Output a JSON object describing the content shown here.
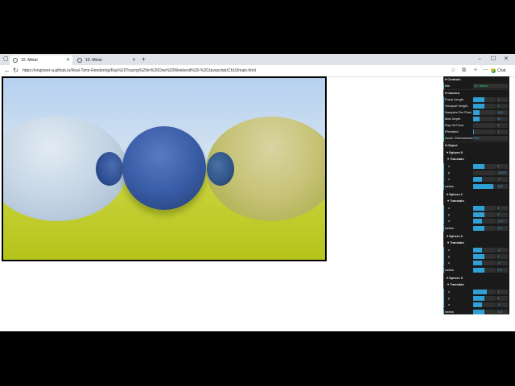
{
  "tabs": [
    {
      "label": "10. Metal",
      "active": true
    },
    {
      "label": "10. Metal",
      "active": false
    }
  ],
  "address": {
    "url": "https://engineer-a.github.io/Real-Time-Rendering/Ray%20Tracing%20in%20One%20Weekend%20-%20Javascript/Ch10/main.html"
  },
  "chat_label": "Chat",
  "scene": {
    "spheres": [
      {
        "color": "#c7d7e6",
        "shape": "left metal sphere"
      },
      {
        "color": "#2e4e93",
        "shape": "small blue sphere"
      },
      {
        "color": "#3a5da8",
        "shape": "center diffuse sphere"
      },
      {
        "color": "#2f5487",
        "shape": "small blue sphere"
      },
      {
        "color": "#c8c47a",
        "shape": "right gold metal sphere"
      }
    ]
  },
  "panel": {
    "controls_title": "Controls",
    "title_label": "title",
    "title_value": "10. Metal",
    "camera_title": "Camera",
    "camera": [
      {
        "label": "Focal Length",
        "value": "1",
        "fill": 0.5
      },
      {
        "label": "Viewport Height",
        "value": "2",
        "fill": 0.5
      },
      {
        "label": "Samples Per Pixel",
        "value": "100",
        "fill": 0.3
      },
      {
        "label": "Max Depth",
        "value": "50",
        "fill": 0.3
      },
      {
        "label": "Ray Hit Floor",
        "value": "0",
        "fill": 0.0
      },
      {
        "label": "Pixelated",
        "value": "1",
        "fill": 0.05
      }
    ],
    "accel_label": "Accel. Performance",
    "accel_value": "Yes",
    "object_title": "Object",
    "spheres": [
      {
        "title": "Sphere 0",
        "translate": "Translate",
        "x": "0",
        "y": "-100.5",
        "z": "-1",
        "radius_label": "radius",
        "radius": "100",
        "fx": 0.5,
        "fy": 0.0,
        "fz": 0.4,
        "fr": 0.9
      },
      {
        "title": "Sphere 1",
        "translate": "Translate",
        "x": "0",
        "y": "0",
        "z": "-1.2",
        "radius_label": "radius",
        "radius": "0.5",
        "fx": 0.5,
        "fy": 0.5,
        "fz": 0.4,
        "fr": 0.5
      },
      {
        "title": "Sphere 2",
        "translate": "Translate",
        "x": "-1",
        "y": "0",
        "z": "-1",
        "radius_label": "radius",
        "radius": "0.5",
        "fx": 0.4,
        "fy": 0.5,
        "fz": 0.4,
        "fr": 0.5
      },
      {
        "title": "Sphere 3",
        "translate": "Translate",
        "x": "1",
        "y": "0",
        "z": "-1",
        "radius_label": "radius",
        "radius": "0.5",
        "fx": 0.6,
        "fy": 0.5,
        "fz": 0.4,
        "fr": 0.5
      }
    ],
    "accent": "#2fa1d6"
  }
}
